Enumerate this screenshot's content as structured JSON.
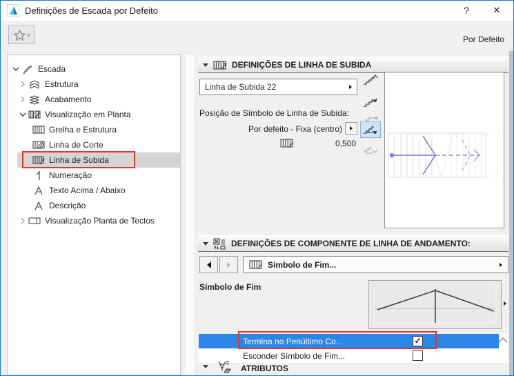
{
  "window": {
    "title": "Definições de Escada por Defeito",
    "help_label": "?",
    "close_label": "✕"
  },
  "toolbar": {
    "default_scope_label": "Por Defeito"
  },
  "tree": {
    "items": [
      {
        "label": "Escada"
      },
      {
        "label": "Estrutura"
      },
      {
        "label": "Acabamento"
      },
      {
        "label": "Visualização em Planta"
      },
      {
        "label": "Grelha e Estrutura"
      },
      {
        "label": "Linha de Corte"
      },
      {
        "label": "Linha de Subida"
      },
      {
        "label": "Numeração"
      },
      {
        "label": "Texto Acima / Abaixo"
      },
      {
        "label": "Descrição"
      },
      {
        "label": "Visualização Planta de Tectos"
      }
    ],
    "selected": "Linha de Subida"
  },
  "walk_line_section": {
    "header": "DEFINIÇÕES DE LINHA DE SUBIDA",
    "style_value": "Linha de Subida 22",
    "position_label": "Posição de Símbolo de Linha de Subida:",
    "position_value": "Por defeito - Fixa (centro)",
    "offset_value": "0,500"
  },
  "component_section": {
    "header": "DEFINIÇÕES DE COMPONENTE DE LINHA DE ANDAMENTO:",
    "component_value": "Símbolo de Fim...",
    "end_symbol_label": "Símbolo de Fim",
    "options": [
      {
        "label": "Termina no Penúltimo Co...",
        "check": "✓",
        "checked": true
      },
      {
        "label": "Esconder Símbolo de Fim...",
        "check": "",
        "checked": false
      }
    ]
  },
  "attributes_section": {
    "header": "ATRIBUTOS"
  },
  "colors": {
    "selection_blue": "#2d86e5",
    "annotation_red": "#dd372e",
    "window_border_blue": "#0f7bd5",
    "walking_line_blue": "#7474dc"
  },
  "icons": {
    "app": "archicad-logo",
    "favorites": "star-icon",
    "sections": [
      "walking-line-grid-icon",
      "component-settings-icon",
      "attributes-pen-icon"
    ]
  }
}
